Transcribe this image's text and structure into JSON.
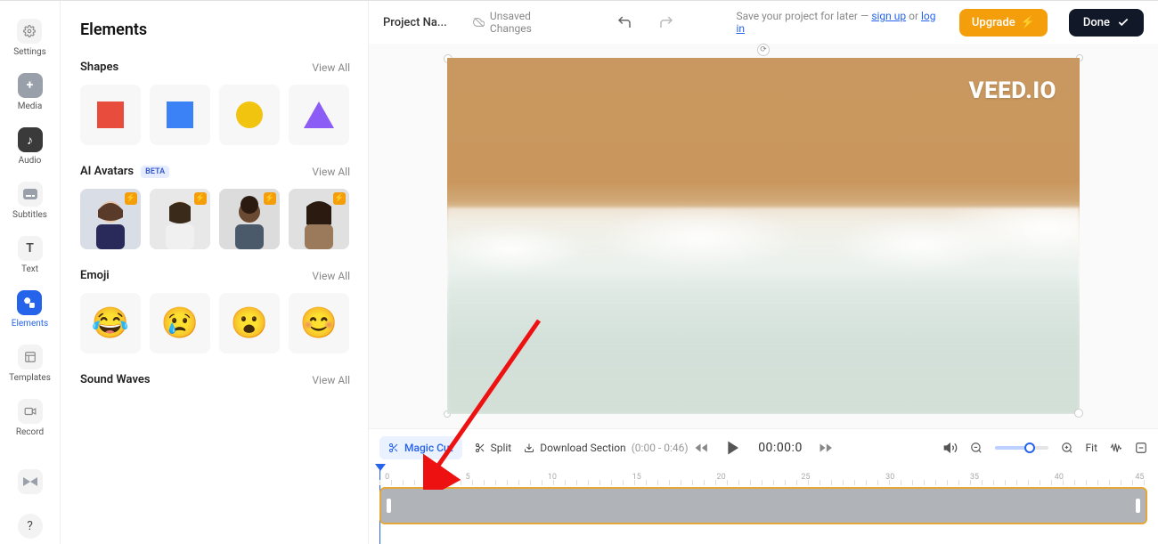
{
  "rail": {
    "items": [
      {
        "label": "Settings",
        "icon": "gear"
      },
      {
        "label": "Media",
        "icon": "plus"
      },
      {
        "label": "Audio",
        "icon": "note"
      },
      {
        "label": "Subtitles",
        "icon": "cc"
      },
      {
        "label": "Text",
        "icon": "T"
      },
      {
        "label": "Elements",
        "icon": "shapes"
      },
      {
        "label": "Templates",
        "icon": "layout"
      },
      {
        "label": "Record",
        "icon": "camera"
      }
    ]
  },
  "panel": {
    "title": "Elements",
    "shapes": {
      "title": "Shapes",
      "viewall": "View All"
    },
    "avatars": {
      "title": "AI Avatars",
      "badge": "BETA",
      "viewall": "View All"
    },
    "emoji": {
      "title": "Emoji",
      "viewall": "View All",
      "items": [
        "😂",
        "😢",
        "😮",
        "😊"
      ]
    },
    "soundwaves": {
      "title": "Sound Waves",
      "viewall": "View All"
    }
  },
  "topbar": {
    "project": "Project Na...",
    "unsaved": "Unsaved Changes",
    "save_prefix": "Save your project for later — ",
    "signup": "sign up",
    "or": " or ",
    "login": "log in",
    "upgrade": "Upgrade",
    "done": "Done"
  },
  "canvas": {
    "watermark": "VEED.IO"
  },
  "controls": {
    "magic_cut": "Magic Cut",
    "split": "Split",
    "download": "Download Section",
    "download_range": "(0:00 - 0:46)",
    "timecode": "00:00:0",
    "fit": "Fit"
  },
  "timeline": {
    "marks": [
      "0",
      "5",
      "10",
      "15",
      "20",
      "25",
      "30",
      "35",
      "40",
      "45"
    ]
  }
}
